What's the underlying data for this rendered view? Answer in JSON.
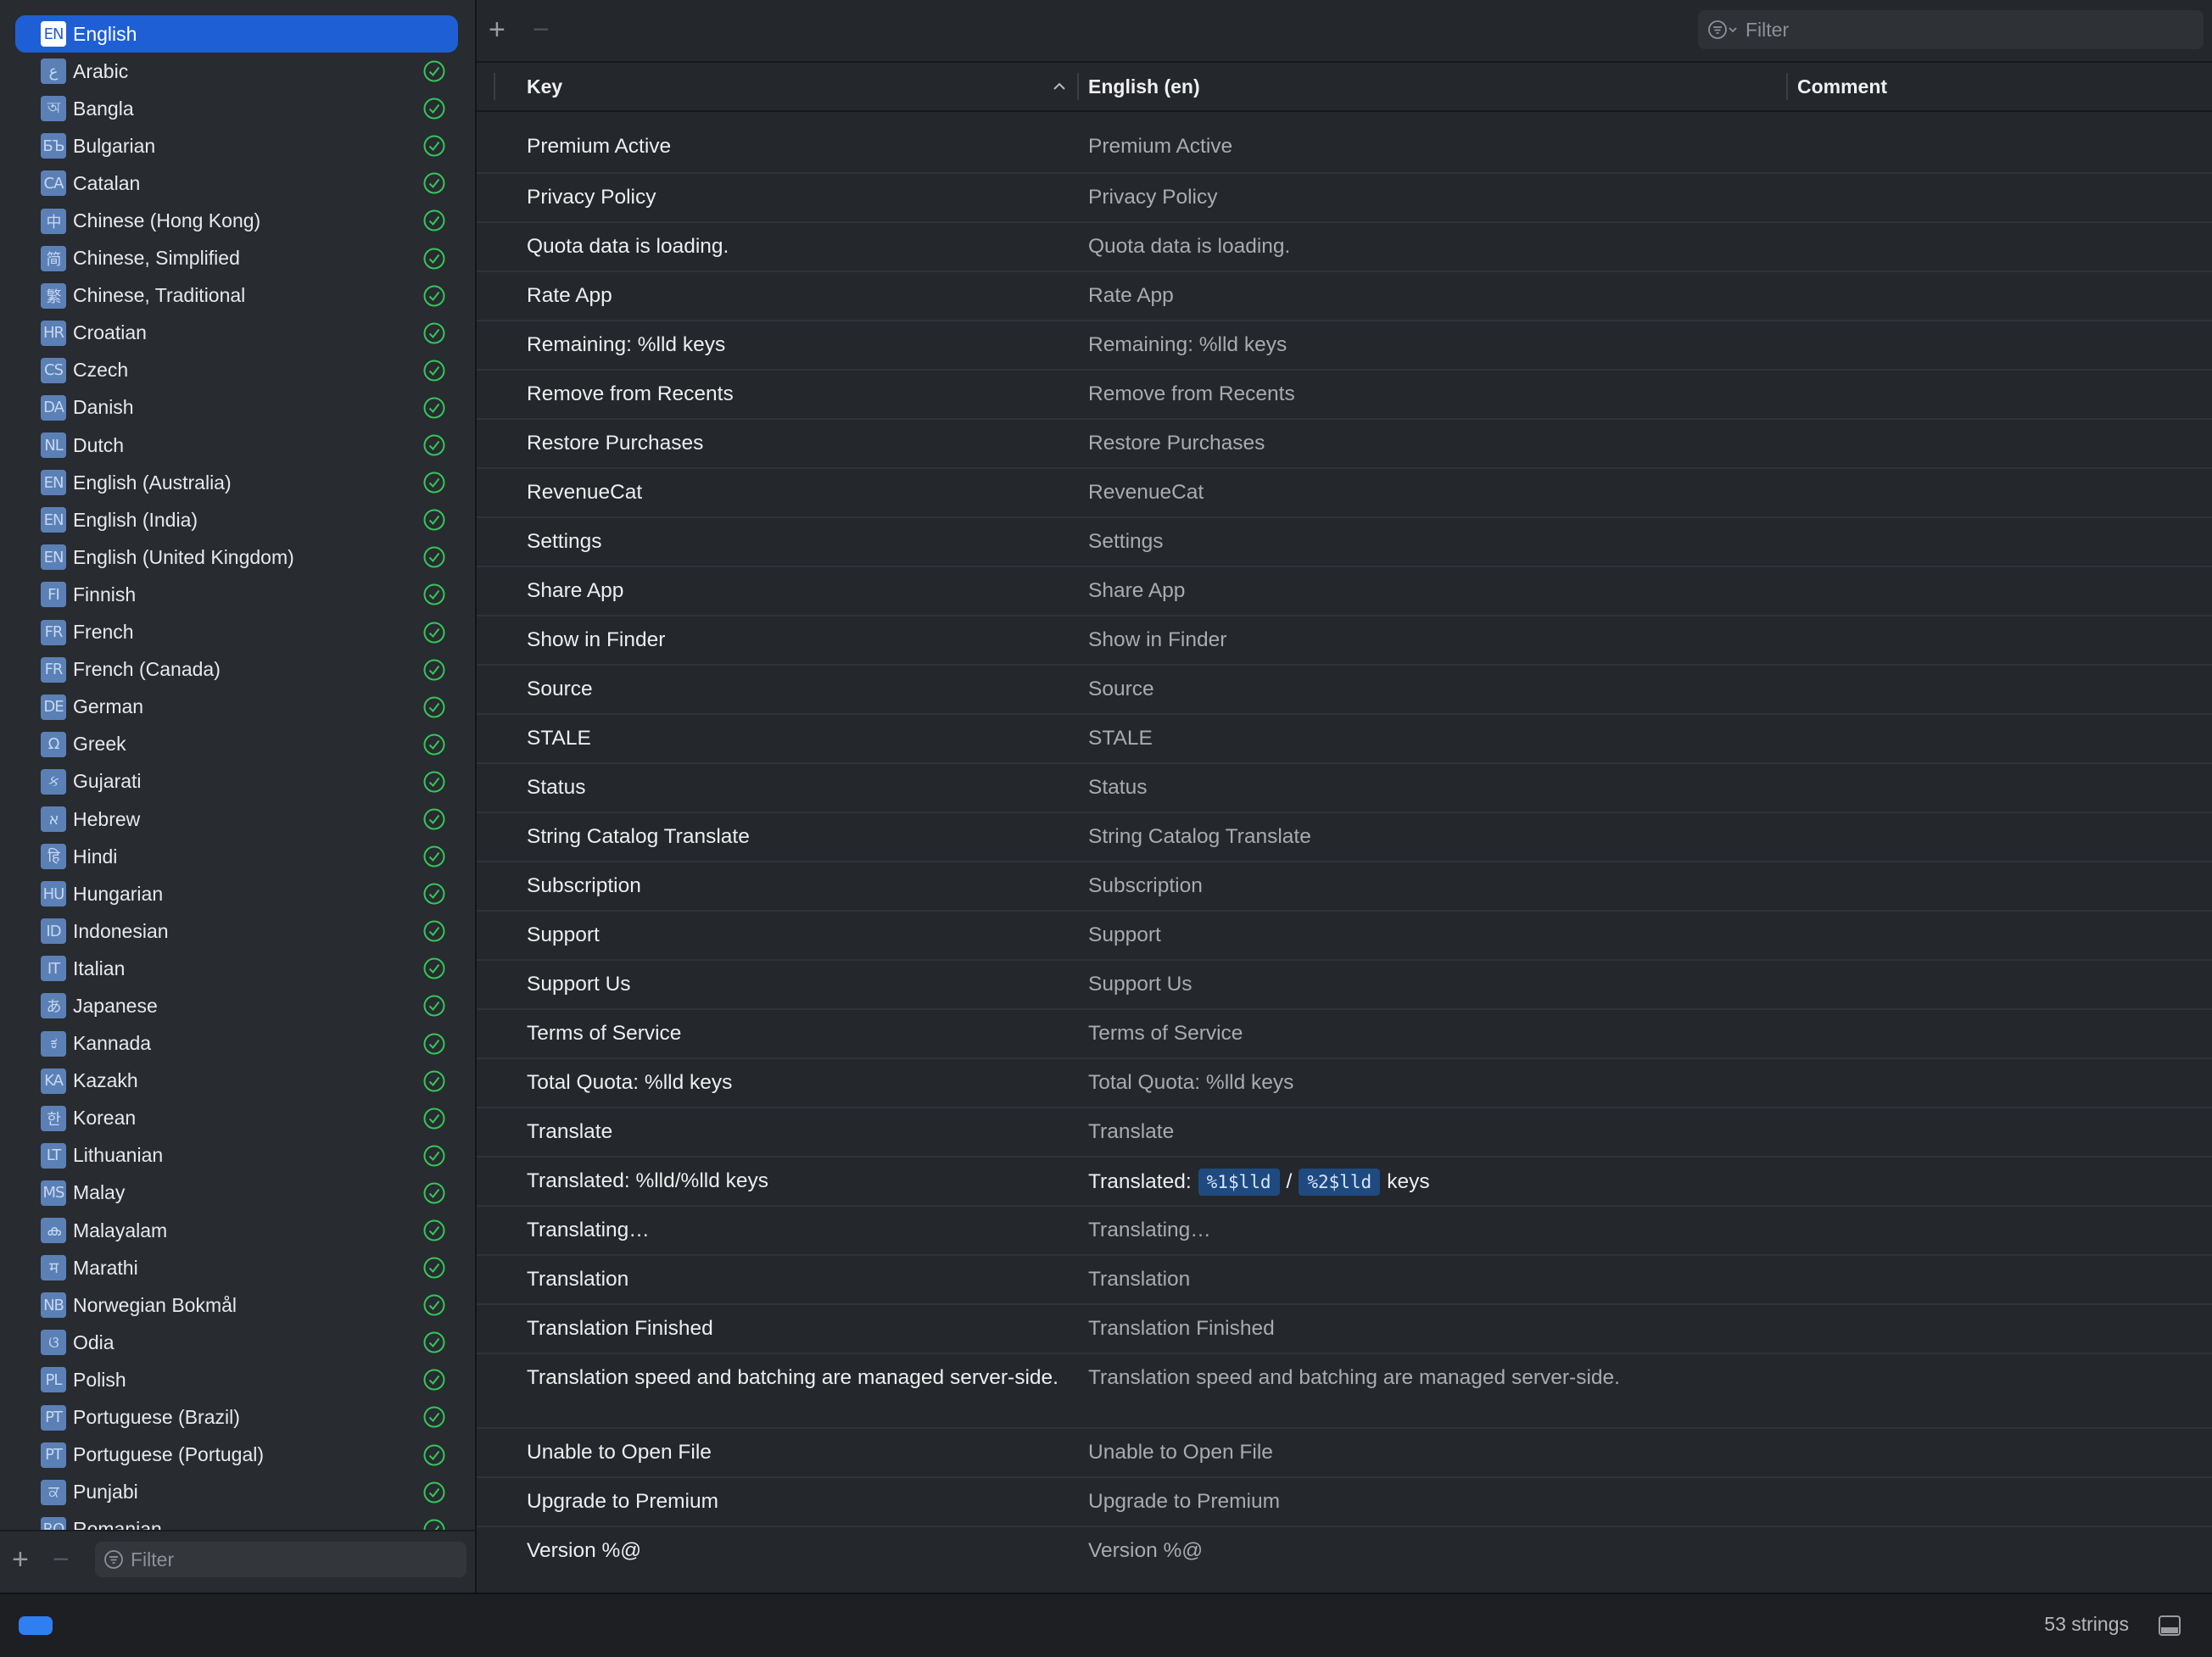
{
  "sidebar": {
    "languages": [
      {
        "code": "EN",
        "label": "English",
        "selected": true
      },
      {
        "code": "ع",
        "label": "Arabic"
      },
      {
        "code": "অ",
        "label": "Bangla"
      },
      {
        "code": "БЪ",
        "label": "Bulgarian"
      },
      {
        "code": "CA",
        "label": "Catalan"
      },
      {
        "code": "中",
        "label": "Chinese (Hong Kong)"
      },
      {
        "code": "简",
        "label": "Chinese, Simplified"
      },
      {
        "code": "繁",
        "label": "Chinese, Traditional"
      },
      {
        "code": "HR",
        "label": "Croatian"
      },
      {
        "code": "CS",
        "label": "Czech"
      },
      {
        "code": "DA",
        "label": "Danish"
      },
      {
        "code": "NL",
        "label": "Dutch"
      },
      {
        "code": "EN",
        "label": "English (Australia)"
      },
      {
        "code": "EN",
        "label": "English (India)"
      },
      {
        "code": "EN",
        "label": "English (United Kingdom)"
      },
      {
        "code": "FI",
        "label": "Finnish"
      },
      {
        "code": "FR",
        "label": "French"
      },
      {
        "code": "FR",
        "label": "French (Canada)"
      },
      {
        "code": "DE",
        "label": "German"
      },
      {
        "code": "Ω",
        "label": "Greek"
      },
      {
        "code": "ક",
        "label": "Gujarati"
      },
      {
        "code": "א",
        "label": "Hebrew"
      },
      {
        "code": "हि",
        "label": "Hindi"
      },
      {
        "code": "HU",
        "label": "Hungarian"
      },
      {
        "code": "ID",
        "label": "Indonesian"
      },
      {
        "code": "IT",
        "label": "Italian"
      },
      {
        "code": "あ",
        "label": "Japanese"
      },
      {
        "code": "ಕ",
        "label": "Kannada"
      },
      {
        "code": "KA",
        "label": "Kazakh"
      },
      {
        "code": "한",
        "label": "Korean"
      },
      {
        "code": "LT",
        "label": "Lithuanian"
      },
      {
        "code": "MS",
        "label": "Malay"
      },
      {
        "code": "ക",
        "label": "Malayalam"
      },
      {
        "code": "म",
        "label": "Marathi"
      },
      {
        "code": "NB",
        "label": "Norwegian Bokmål"
      },
      {
        "code": "ଓ",
        "label": "Odia"
      },
      {
        "code": "PL",
        "label": "Polish"
      },
      {
        "code": "PT",
        "label": "Portuguese (Brazil)"
      },
      {
        "code": "PT",
        "label": "Portuguese (Portugal)"
      },
      {
        "code": "ਕ",
        "label": "Punjabi"
      },
      {
        "code": "RO",
        "label": "Romanian"
      }
    ],
    "filter_placeholder": "Filter",
    "add_label": "+",
    "remove_label": "−"
  },
  "toolbar": {
    "add_label": "+",
    "remove_label": "−",
    "filter_placeholder": "Filter"
  },
  "table": {
    "headers": {
      "key": "Key",
      "value": "English (en)",
      "comment": "Comment"
    },
    "rows": [
      {
        "key": "Premium Active",
        "value": "Premium Active"
      },
      {
        "key": "Privacy Policy",
        "value": "Privacy Policy"
      },
      {
        "key": "Quota data is loading.",
        "value": "Quota data is loading."
      },
      {
        "key": "Rate App",
        "value": "Rate App"
      },
      {
        "key": "Remaining: %lld keys",
        "value": "Remaining: %lld keys"
      },
      {
        "key": "Remove from Recents",
        "value": "Remove from Recents"
      },
      {
        "key": "Restore Purchases",
        "value": "Restore Purchases"
      },
      {
        "key": "RevenueCat",
        "value": "RevenueCat"
      },
      {
        "key": "Settings",
        "value": "Settings"
      },
      {
        "key": "Share App",
        "value": "Share App"
      },
      {
        "key": "Show in Finder",
        "value": "Show in Finder"
      },
      {
        "key": "Source",
        "value": "Source"
      },
      {
        "key": "STALE",
        "value": "STALE"
      },
      {
        "key": "Status",
        "value": "Status"
      },
      {
        "key": "String Catalog Translate",
        "value": "String Catalog Translate"
      },
      {
        "key": "Subscription",
        "value": "Subscription"
      },
      {
        "key": "Support",
        "value": "Support"
      },
      {
        "key": "Support Us",
        "value": "Support Us"
      },
      {
        "key": "Terms of Service",
        "value": "Terms of Service"
      },
      {
        "key": "Total Quota: %lld keys",
        "value": "Total Quota: %lld keys"
      },
      {
        "key": "Translate",
        "value": "Translate"
      },
      {
        "key": "Translated: %lld/%lld keys",
        "value_parts": [
          "Translated:",
          "%1$lld",
          "/",
          "%2$lld",
          "keys"
        ]
      },
      {
        "key": "Translating…",
        "value": "Translating…"
      },
      {
        "key": "Translation",
        "value": "Translation"
      },
      {
        "key": "Translation Finished",
        "value": "Translation Finished"
      },
      {
        "key": "Translation speed and batching are managed server-side.",
        "value": "Translation speed and batching are managed server-side.",
        "tall": true
      },
      {
        "key": "Unable to Open File",
        "value": "Unable to Open File"
      },
      {
        "key": "Upgrade to Premium",
        "value": "Upgrade to Premium"
      },
      {
        "key": "Version %@",
        "value": "Version %@"
      }
    ]
  },
  "status": {
    "count_text": "53 strings"
  },
  "colors": {
    "accent": "#1f5fd6",
    "check": "#34c759",
    "token_bg": "#1e4a7f"
  },
  "icons": [
    "filter-icon",
    "checkmark-circle-icon",
    "sort-ascending-icon",
    "panel-toggle-icon"
  ]
}
